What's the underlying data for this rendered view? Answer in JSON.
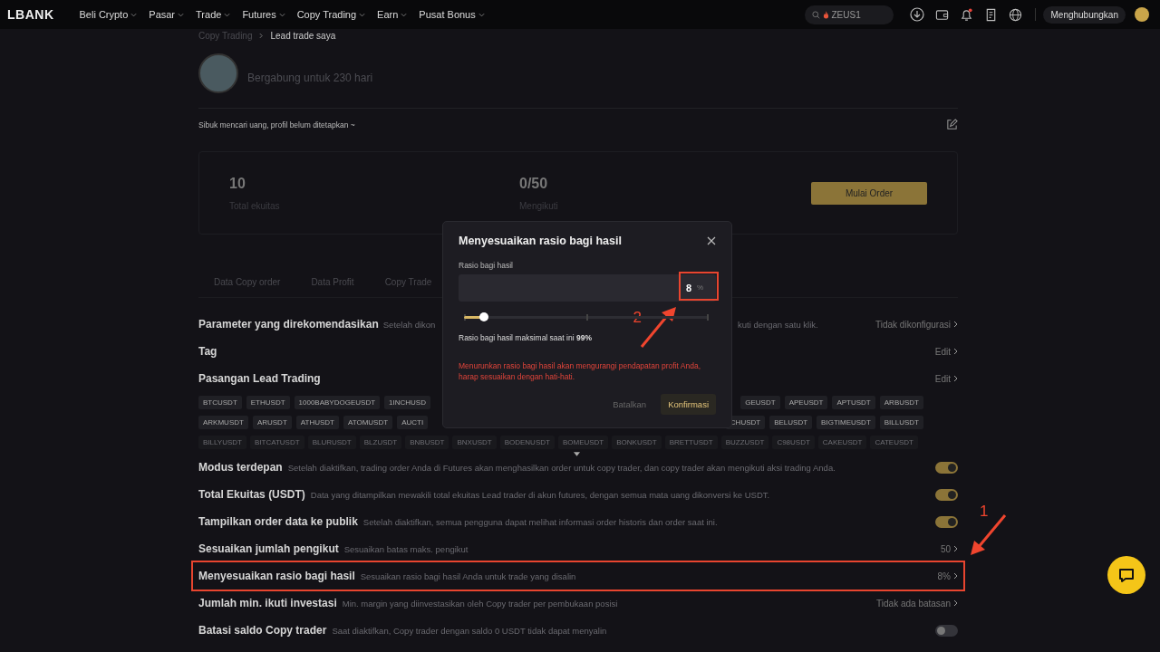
{
  "nav": {
    "logo": "LBANK",
    "menu": [
      {
        "label": "Beli Crypto"
      },
      {
        "label": "Pasar"
      },
      {
        "label": "Trade"
      },
      {
        "label": "Futures"
      },
      {
        "label": "Copy Trading"
      },
      {
        "label": "Earn"
      },
      {
        "label": "Pusat Bonus"
      }
    ],
    "search": {
      "value": "ZEUS1"
    },
    "connect_button": "Menghubungkan"
  },
  "breadcrumb": [
    {
      "label": "Copy Trading",
      "selected": false
    },
    {
      "label": "Lead trade saya",
      "selected": true
    }
  ],
  "profile": {
    "joined": "Bergabung untuk 230 hari",
    "bio": "Sibuk mencari uang, profil belum ditetapkan ~"
  },
  "stats": [
    {
      "value": "10",
      "label": "Total ekuitas"
    },
    {
      "value": "0/50",
      "label": "Mengikuti"
    }
  ],
  "start_button": "Mulai Order",
  "tabs": [
    {
      "label": "Data Copy order"
    },
    {
      "label": "Data Profit"
    },
    {
      "label": "Copy Trade"
    }
  ],
  "recommended": {
    "title": "Parameter yang direkomendasikan",
    "desc_start": "Setelah dikon",
    "desc_end": "kuti dengan satu klik.",
    "value": "Tidak dikonfigurasi"
  },
  "tag": {
    "title": "Tag",
    "action": "Edit"
  },
  "pairs": {
    "title": "Pasangan Lead Trading",
    "action": "Edit",
    "rows": [
      {
        "faded": false,
        "left": [
          "BTCUSDT",
          "ETHUSDT",
          "1000BABYDOGEUSDT",
          "1INCHUSD"
        ],
        "right": [
          "GEUSDT",
          "APEUSDT",
          "APTUSDT",
          "ARBUSDT"
        ]
      },
      {
        "faded": false,
        "left": [
          "ARKMUSDT",
          "ARUSDT",
          "ATHUSDT",
          "ATOMUSDT",
          "AUCTI"
        ],
        "right": [
          "CHUSDT",
          "BELUSDT",
          "BIGTIMEUSDT",
          "BILLUSDT"
        ]
      },
      {
        "faded": true,
        "left": [
          "BILLYUSDT",
          "BITCATUSDT",
          "BLURUSDT",
          "BLZUSDT",
          "BNBUSDT",
          "BNXUSDT",
          "BODENUSDT",
          "BOMEUSDT",
          "BONKUSDT",
          "BRETTUSDT",
          "BUZZUSDT",
          "C98USDT",
          "CAKEUSDT",
          "CATEUSDT"
        ],
        "right": []
      }
    ]
  },
  "settings": [
    {
      "kind": "toggle",
      "title": "Modus terdepan",
      "desc": "Setelah diaktifkan, trading order Anda di Futures akan menghasilkan order untuk copy trader, dan copy trader akan mengikuti aksi trading Anda.",
      "on": true
    },
    {
      "kind": "toggle",
      "title": "Total Ekuitas (USDT)",
      "desc": "Data yang ditampilkan mewakili total ekuitas Lead trader di akun futures, dengan semua mata uang dikonversi ke USDT.",
      "on": true
    },
    {
      "kind": "toggle",
      "title": "Tampilkan order data ke publik",
      "desc": "Setelah diaktifkan, semua pengguna dapat melihat informasi order historis dan order saat ini.",
      "on": true
    },
    {
      "kind": "link",
      "title": "Sesuaikan jumlah pengikut",
      "desc": "Sesuaikan batas maks. pengikut",
      "value": "50"
    },
    {
      "kind": "link",
      "title": "Menyesuaikan rasio bagi hasil",
      "desc": "Sesuaikan rasio bagi hasil Anda untuk trade yang disalin",
      "value": "8%",
      "callout": "1"
    },
    {
      "kind": "link",
      "title": "Jumlah min. ikuti investasi",
      "desc": "Min. margin yang diinvestasikan oleh Copy trader per pembukaan posisi",
      "value": "Tidak ada batasan"
    },
    {
      "kind": "toggle",
      "title": "Batasi saldo Copy trader",
      "desc": "Saat diaktifkan, Copy trader dengan saldo 0 USDT tidak dapat menyalin",
      "on": false
    }
  ],
  "modal": {
    "title": "Menyesuaikan rasio bagi hasil",
    "field_label": "Rasio bagi hasil",
    "value": "8",
    "unit": "%",
    "callout": "2",
    "level": 0.08,
    "max_text": "Rasio bagi hasil maksimal saat ini **99%**",
    "warning": "Menurunkan rasio bagi hasil akan mengurangi pendapatan profit Anda, harap sesuaikan dengan hati-hati.",
    "buttons": [
      {
        "kind": "secondary",
        "label": "Batalkan"
      },
      {
        "kind": "primary",
        "label": "Konfirmasi"
      }
    ]
  }
}
